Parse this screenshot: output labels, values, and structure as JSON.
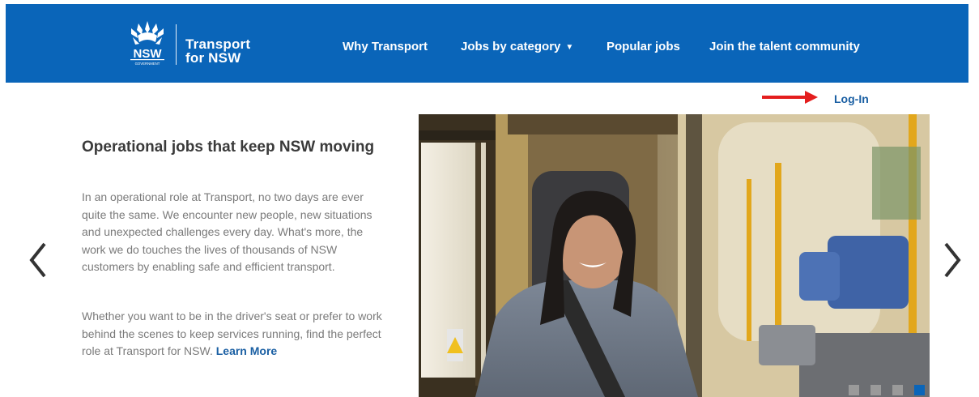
{
  "header": {
    "logo": {
      "badge_text": "NSW",
      "badge_subtext": "GOVERNMENT",
      "brand_line1": "Transport",
      "brand_line2": "for NSW"
    },
    "nav": [
      {
        "label": "Why Transport"
      },
      {
        "label": "Jobs by category",
        "has_dropdown": true
      },
      {
        "label": "Popular jobs"
      },
      {
        "label": "Join the talent community"
      }
    ]
  },
  "login": {
    "label": "Log-In",
    "arrow_color": "#e41e1e"
  },
  "hero": {
    "headline": "Operational jobs that keep NSW moving",
    "paragraph1": "In an operational role at Transport, no two days are ever quite the same. We encounter new people, new situations and unexpected challenges every day. What's more, the work we do touches the lives of thousands of NSW customers by enabling safe and efficient transport.",
    "paragraph2": "Whether you want to be in the driver's seat or prefer to work behind the scenes to keep services running, find the perfect role at Transport for NSW.",
    "learn_more": "Learn More",
    "image_description_icon": "bus-driver-photo",
    "slides": 4,
    "active_slide": 4
  },
  "colors": {
    "brand_blue": "#0a65b9",
    "link_blue": "#1a5fa3",
    "arrow_red": "#e41e1e"
  }
}
